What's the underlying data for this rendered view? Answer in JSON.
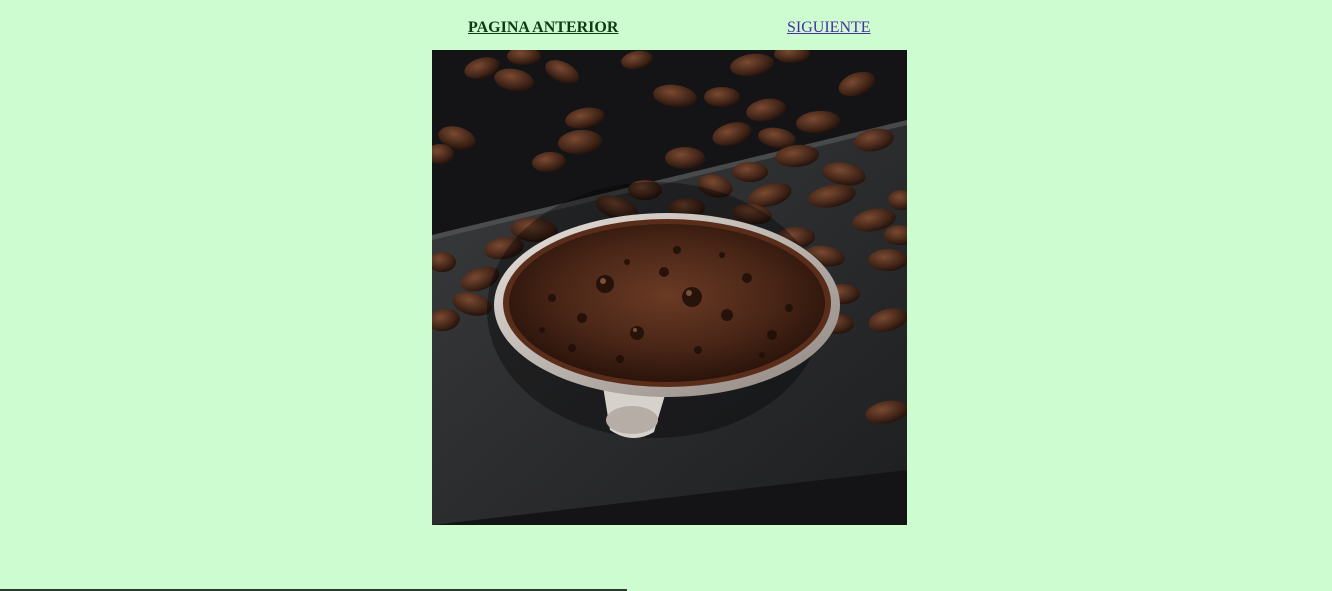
{
  "nav": {
    "previous_label": "PAGINA ANTERIOR",
    "next_label": "SIGUIENTE"
  },
  "colors": {
    "background": "#ccfccf",
    "previous_link": "#0c3d10",
    "next_link": "#4b2fa1"
  }
}
